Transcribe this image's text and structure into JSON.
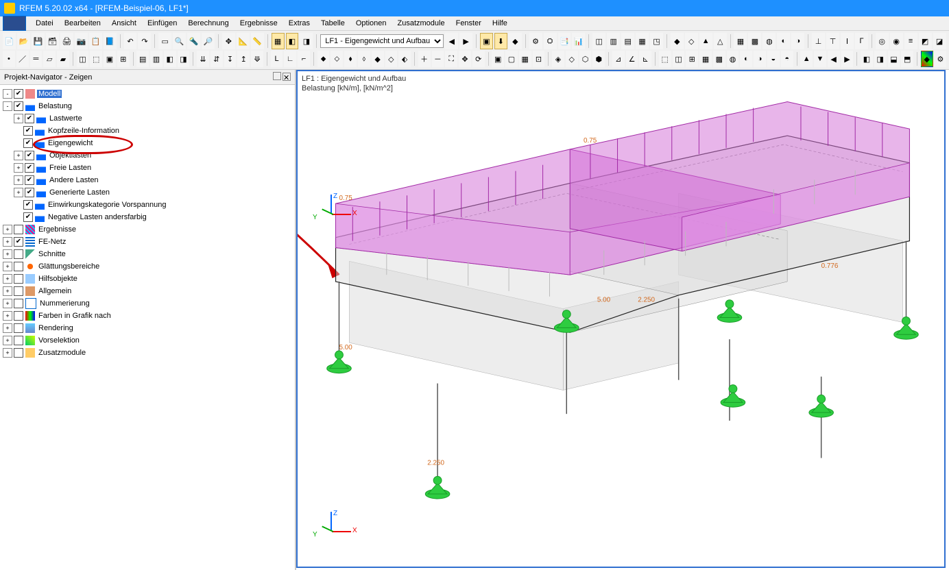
{
  "window": {
    "title": "RFEM 5.20.02 x64 - [RFEM-Beispiel-06, LF1*]"
  },
  "menu": {
    "items": [
      "Datei",
      "Bearbeiten",
      "Ansicht",
      "Einfügen",
      "Berechnung",
      "Ergebnisse",
      "Extras",
      "Tabelle",
      "Optionen",
      "Zusatzmodule",
      "Fenster",
      "Hilfe"
    ]
  },
  "toolbar": {
    "loadcase": "LF1 - Eigengewicht und Aufbau"
  },
  "navigator": {
    "title": "Projekt-Navigator - Zeigen",
    "items": [
      {
        "d": 0,
        "tw": "-",
        "chk": true,
        "ico": "ico-model",
        "lbl": "Modell",
        "sel": true
      },
      {
        "d": 0,
        "tw": "-",
        "chk": true,
        "ico": "ico-load",
        "lbl": "Belastung"
      },
      {
        "d": 1,
        "tw": "+",
        "chk": true,
        "ico": "ico-load",
        "lbl": "Lastwerte"
      },
      {
        "d": 1,
        "tw": "",
        "chk": true,
        "ico": "ico-load",
        "lbl": "Kopfzeile-Information"
      },
      {
        "d": 1,
        "tw": "",
        "chk": true,
        "ico": "ico-load",
        "lbl": "Eigengewicht",
        "circle": true
      },
      {
        "d": 1,
        "tw": "+",
        "chk": true,
        "ico": "ico-load",
        "lbl": "Objektlasten"
      },
      {
        "d": 1,
        "tw": "+",
        "chk": true,
        "ico": "ico-load",
        "lbl": "Freie Lasten"
      },
      {
        "d": 1,
        "tw": "+",
        "chk": true,
        "ico": "ico-load",
        "lbl": "Andere Lasten"
      },
      {
        "d": 1,
        "tw": "+",
        "chk": true,
        "ico": "ico-load",
        "lbl": "Generierte Lasten"
      },
      {
        "d": 1,
        "tw": "",
        "chk": true,
        "ico": "ico-load",
        "lbl": "Einwirkungskategorie Vorspannung"
      },
      {
        "d": 1,
        "tw": "",
        "chk": true,
        "ico": "ico-load",
        "lbl": "Negative Lasten andersfarbig"
      },
      {
        "d": 0,
        "tw": "+",
        "chk": false,
        "ico": "ico-results",
        "lbl": "Ergebnisse"
      },
      {
        "d": 0,
        "tw": "+",
        "chk": true,
        "ico": "ico-fe",
        "lbl": "FE-Netz"
      },
      {
        "d": 0,
        "tw": "+",
        "chk": false,
        "ico": "ico-cut",
        "lbl": "Schnitte"
      },
      {
        "d": 0,
        "tw": "+",
        "chk": false,
        "ico": "ico-smooth",
        "lbl": "Glättungsbereiche"
      },
      {
        "d": 0,
        "tw": "+",
        "chk": false,
        "ico": "ico-help",
        "lbl": "Hilfsobjekte"
      },
      {
        "d": 0,
        "tw": "+",
        "chk": false,
        "ico": "ico-gen",
        "lbl": "Allgemein"
      },
      {
        "d": 0,
        "tw": "+",
        "chk": false,
        "ico": "ico-num",
        "lbl": "Nummerierung"
      },
      {
        "d": 0,
        "tw": "+",
        "chk": false,
        "ico": "ico-cols",
        "lbl": "Farben in Grafik nach"
      },
      {
        "d": 0,
        "tw": "+",
        "chk": false,
        "ico": "ico-rend",
        "lbl": "Rendering"
      },
      {
        "d": 0,
        "tw": "+",
        "chk": false,
        "ico": "ico-presel",
        "lbl": "Vorselektion"
      },
      {
        "d": 0,
        "tw": "+",
        "chk": false,
        "ico": "ico-addon",
        "lbl": "Zusatzmodule"
      }
    ]
  },
  "viewport": {
    "caption1": "LF1 : Eigengewicht und Aufbau",
    "caption2": "Belastung [kN/m], [kN/m^2]",
    "loads": {
      "left": "0.75",
      "right": "0.75",
      "dim_right": "0.776"
    },
    "dims": {
      "a": "5.00",
      "b": "2.250",
      "c": "5.00",
      "d": "2.250"
    }
  }
}
